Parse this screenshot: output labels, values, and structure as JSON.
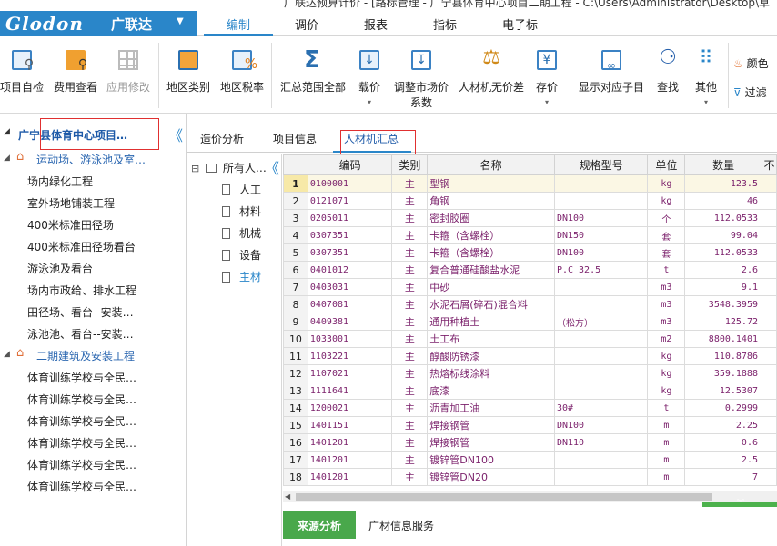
{
  "window": {
    "title_fragment": "广联达预算计价 - [路标管理 - 广宁县体育中心项目二期工程 - C:\\Users\\Administrator\\Desktop\\草"
  },
  "logo": {
    "brand": "Glodon",
    "cn": "广联达",
    "arrow": "▼"
  },
  "menu": {
    "items": [
      "编制",
      "调价",
      "报表",
      "指标",
      "电子标"
    ],
    "active": "编制"
  },
  "toolbar": {
    "buttons": [
      {
        "label": "项目自检"
      },
      {
        "label": "费用查看"
      },
      {
        "label": "应用修改",
        "disabled": true
      },
      {
        "label": "地区类别"
      },
      {
        "label": "地区税率"
      },
      {
        "label": "汇总范围全部"
      },
      {
        "label": "载价"
      },
      {
        "label": "调整市场价"
      },
      {
        "label": "系数"
      },
      {
        "label": "人材机无价差"
      },
      {
        "label": "存价"
      },
      {
        "label": "显示对应子目"
      },
      {
        "label": "查找"
      },
      {
        "label": "其他"
      },
      {
        "label": "颜色"
      },
      {
        "label": "过滤"
      }
    ],
    "dropdown_arrow": "▾"
  },
  "project_tree": {
    "title": "广宁县体育中心项目…",
    "groups": [
      {
        "label": "运动场、游泳池及室…",
        "children": [
          "场内绿化工程",
          "室外场地铺装工程",
          "400米标准田径场",
          "400米标准田径场看台",
          "游泳池及看台",
          "场内市政给、排水工程",
          "田径场、看台--安装…",
          "泳池池、看台--安装…"
        ]
      },
      {
        "label": "二期建筑及安装工程",
        "children": [
          "体育训练学校与全民…",
          "体育训练学校与全民…",
          "体育训练学校与全民…",
          "体育训练学校与全民…",
          "体育训练学校与全民…",
          "体育训练学校与全民…"
        ]
      }
    ],
    "collapse_glyph": "《",
    "expand_glyph": "⊟"
  },
  "tabs": [
    "造价分析",
    "项目信息",
    "人材机汇总"
  ],
  "active_tab": "人材机汇总",
  "category_tree": {
    "root": "所有人…",
    "items": [
      "人工",
      "材料",
      "机械",
      "设备",
      "主材"
    ],
    "selected": "主材"
  },
  "grid": {
    "columns": [
      "",
      "编码",
      "类别",
      "名称",
      "规格型号",
      "单位",
      "数量",
      "不"
    ],
    "rows": [
      [
        "1",
        "0100001",
        "主",
        "型钢",
        "",
        "kg",
        "123.5"
      ],
      [
        "2",
        "0121071",
        "主",
        "角钢",
        "",
        "kg",
        "46"
      ],
      [
        "3",
        "0205011",
        "主",
        "密封胶圈",
        "DN100",
        "个",
        "112.0533"
      ],
      [
        "4",
        "0307351",
        "主",
        "卡箍（含螺栓）",
        "DN150",
        "套",
        "99.04"
      ],
      [
        "5",
        "0307351",
        "主",
        "卡箍（含螺栓）",
        "DN100",
        "套",
        "112.0533"
      ],
      [
        "6",
        "0401012",
        "主",
        "复合普通硅酸盐水泥",
        "P.C 32.5",
        "t",
        "2.6"
      ],
      [
        "7",
        "0403031",
        "主",
        "中砂",
        "",
        "m3",
        "9.1"
      ],
      [
        "8",
        "0407081",
        "主",
        "水泥石屑(碎石)混合料",
        "",
        "m3",
        "3548.3959"
      ],
      [
        "9",
        "0409381",
        "主",
        "通用种植土",
        "（松方）",
        "m3",
        "125.72"
      ],
      [
        "10",
        "1033001",
        "主",
        "土工布",
        "",
        "m2",
        "8800.1401"
      ],
      [
        "11",
        "1103221",
        "主",
        "醇酸防锈漆",
        "",
        "kg",
        "110.8786"
      ],
      [
        "12",
        "1107021",
        "主",
        "热熔标线涂料",
        "",
        "kg",
        "359.1888"
      ],
      [
        "13",
        "1111641",
        "主",
        "底漆",
        "",
        "kg",
        "12.5307"
      ],
      [
        "14",
        "1200021",
        "主",
        "沥青加工油",
        "30#",
        "t",
        "0.2999"
      ],
      [
        "15",
        "1401151",
        "主",
        "焊接钢管",
        "DN100",
        "m",
        "2.25"
      ],
      [
        "16",
        "1401201",
        "主",
        "焊接钢管",
        "DN110",
        "m",
        "0.6"
      ],
      [
        "17",
        "1401201",
        "主",
        "镀锌管DN100",
        "",
        "m",
        "2.5"
      ],
      [
        "18",
        "1401201",
        "主",
        "镀锌管DN20",
        "",
        "m",
        "7"
      ]
    ],
    "selected_row": 1
  },
  "scroll": {
    "left_arrow": "◀",
    "collapse_glyph": "︾"
  },
  "bottom_tabs": [
    "来源分析",
    "广材信息服务"
  ],
  "colors": {
    "accent": "#2a86c9",
    "green": "#49a84b",
    "highlight_red": "#e03030",
    "data_text": "#7a1f6a"
  }
}
